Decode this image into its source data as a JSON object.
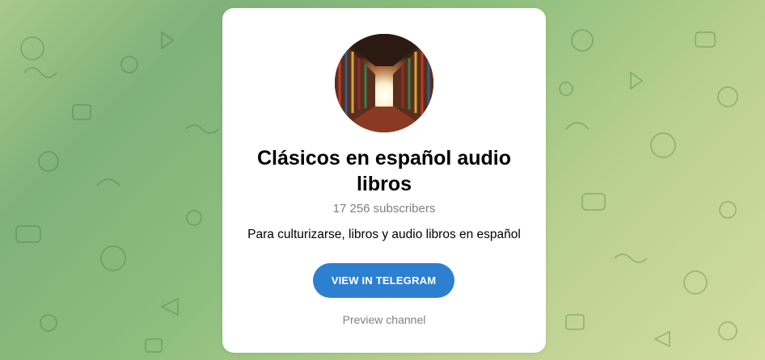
{
  "channel": {
    "title": "Clásicos en español audio libros",
    "subscribers": "17 256 subscribers",
    "description": "Para culturizarse, libros y audio libros en español"
  },
  "actions": {
    "view_label": "VIEW IN TELEGRAM",
    "preview_label": "Preview channel"
  },
  "colors": {
    "accent": "#2d80cf",
    "muted_text": "#7d7f81",
    "background_green": "#7fb27a",
    "background_yellow": "#d3dca2"
  },
  "icons": {
    "avatar": "library-hallway-image",
    "background": "doodle-pattern"
  }
}
